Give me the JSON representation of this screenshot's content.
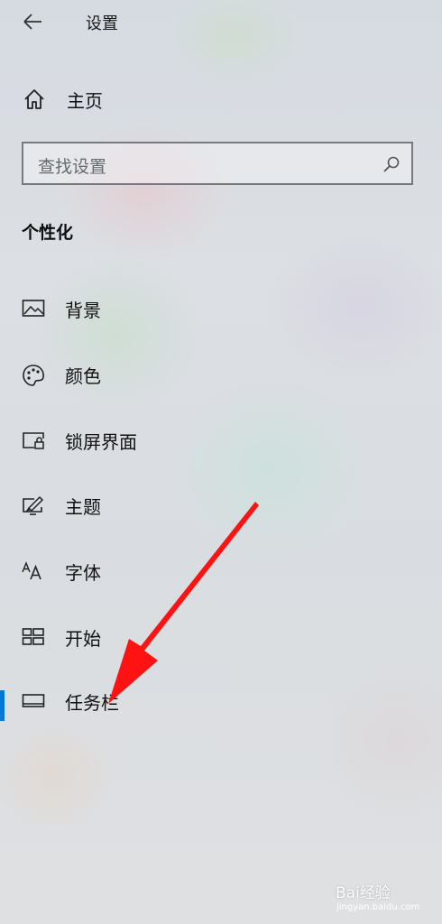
{
  "header": {
    "title": "设置"
  },
  "home": {
    "label": "主页"
  },
  "search": {
    "placeholder": "查找设置"
  },
  "section": {
    "heading": "个性化"
  },
  "nav": {
    "items": [
      {
        "label": "背景",
        "icon": "image-icon"
      },
      {
        "label": "颜色",
        "icon": "palette-icon"
      },
      {
        "label": "锁屏界面",
        "icon": "lock-screen-icon"
      },
      {
        "label": "主题",
        "icon": "theme-brush-icon"
      },
      {
        "label": "字体",
        "icon": "font-icon"
      },
      {
        "label": "开始",
        "icon": "start-tiles-icon"
      },
      {
        "label": "任务栏",
        "icon": "taskbar-icon",
        "selected": true
      }
    ]
  },
  "colors": {
    "accent": "#0078d7",
    "arrow": "#ff1010"
  },
  "watermark": {
    "brand": "Bai经验",
    "url": "jingyan.baidu.com"
  }
}
